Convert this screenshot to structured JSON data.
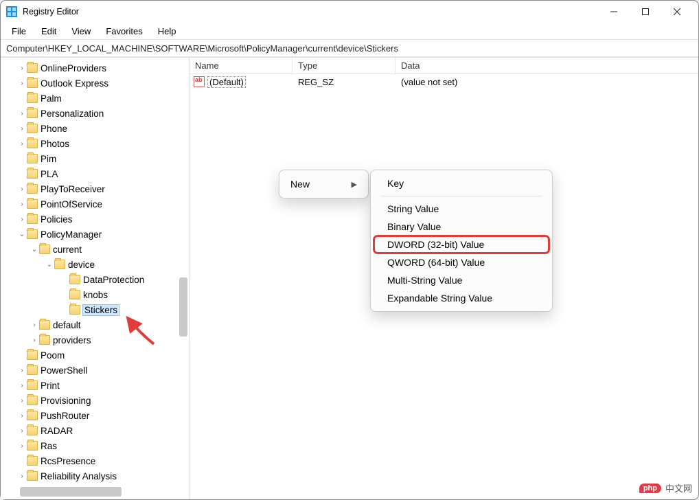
{
  "window": {
    "title": "Registry Editor"
  },
  "menubar": [
    "File",
    "Edit",
    "View",
    "Favorites",
    "Help"
  ],
  "address": "Computer\\HKEY_LOCAL_MACHINE\\SOFTWARE\\Microsoft\\PolicyManager\\current\\device\\Stickers",
  "tree": [
    {
      "depth": 0,
      "twisty": ">",
      "label": "OnlineProviders"
    },
    {
      "depth": 0,
      "twisty": ">",
      "label": "Outlook Express"
    },
    {
      "depth": 0,
      "twisty": "",
      "label": "Palm"
    },
    {
      "depth": 0,
      "twisty": ">",
      "label": "Personalization"
    },
    {
      "depth": 0,
      "twisty": ">",
      "label": "Phone"
    },
    {
      "depth": 0,
      "twisty": ">",
      "label": "Photos"
    },
    {
      "depth": 0,
      "twisty": "",
      "label": "Pim"
    },
    {
      "depth": 0,
      "twisty": "",
      "label": "PLA"
    },
    {
      "depth": 0,
      "twisty": ">",
      "label": "PlayToReceiver"
    },
    {
      "depth": 0,
      "twisty": ">",
      "label": "PointOfService"
    },
    {
      "depth": 0,
      "twisty": ">",
      "label": "Policies"
    },
    {
      "depth": 0,
      "twisty": "v",
      "label": "PolicyManager"
    },
    {
      "depth": 1,
      "twisty": "v",
      "label": "current"
    },
    {
      "depth": 2,
      "twisty": "v",
      "label": "device"
    },
    {
      "depth": 3,
      "twisty": "",
      "label": "DataProtection"
    },
    {
      "depth": 3,
      "twisty": "",
      "label": "knobs"
    },
    {
      "depth": 3,
      "twisty": "",
      "label": "Stickers",
      "selected": true
    },
    {
      "depth": 1,
      "twisty": ">",
      "label": "default"
    },
    {
      "depth": 1,
      "twisty": ">",
      "label": "providers"
    },
    {
      "depth": 0,
      "twisty": "",
      "label": "Poom"
    },
    {
      "depth": 0,
      "twisty": ">",
      "label": "PowerShell"
    },
    {
      "depth": 0,
      "twisty": ">",
      "label": "Print"
    },
    {
      "depth": 0,
      "twisty": ">",
      "label": "Provisioning"
    },
    {
      "depth": 0,
      "twisty": ">",
      "label": "PushRouter"
    },
    {
      "depth": 0,
      "twisty": ">",
      "label": "RADAR"
    },
    {
      "depth": 0,
      "twisty": ">",
      "label": "Ras"
    },
    {
      "depth": 0,
      "twisty": "",
      "label": "RcsPresence"
    },
    {
      "depth": 0,
      "twisty": ">",
      "label": "Reliability Analysis"
    }
  ],
  "columns": {
    "name": "Name",
    "type": "Type",
    "data": "Data"
  },
  "values": [
    {
      "name": "(Default)",
      "type": "REG_SZ",
      "data": "(value not set)"
    }
  ],
  "context1": {
    "new": "New"
  },
  "context2": [
    {
      "label": "Key",
      "kind": "item"
    },
    {
      "kind": "divider"
    },
    {
      "label": "String Value",
      "kind": "item"
    },
    {
      "label": "Binary Value",
      "kind": "item"
    },
    {
      "label": "DWORD (32-bit) Value",
      "kind": "item",
      "highlight": true
    },
    {
      "label": "QWORD (64-bit) Value",
      "kind": "item"
    },
    {
      "label": "Multi-String Value",
      "kind": "item"
    },
    {
      "label": "Expandable String Value",
      "kind": "item"
    }
  ],
  "watermark": {
    "badge": "php",
    "text": "中文网"
  }
}
